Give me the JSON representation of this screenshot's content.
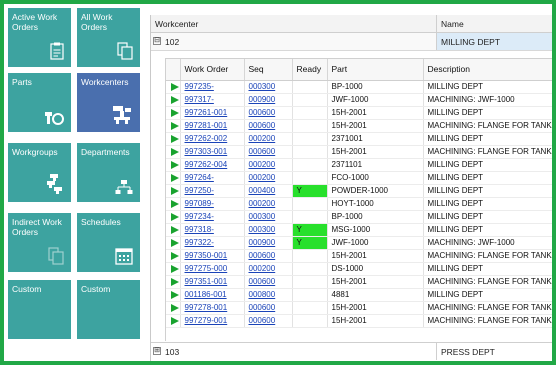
{
  "tiles": [
    {
      "label": "Active Work Orders",
      "icon": "clipboard-icon",
      "active": false
    },
    {
      "label": "All Work Orders",
      "icon": "documents-icon",
      "active": false
    },
    {
      "label": "Parts",
      "icon": "bolt-nut-icon",
      "active": false
    },
    {
      "label": "Workcenters",
      "icon": "machine-icon",
      "active": true
    },
    {
      "label": "Workgroups",
      "icon": "workgroup-machines-icon",
      "active": false
    },
    {
      "label": "Departments",
      "icon": "org-chart-icon",
      "active": false
    },
    {
      "label": "Indirect Work Orders",
      "icon": "documents-faded-icon",
      "active": false
    },
    {
      "label": "Schedules",
      "icon": "calendar-icon",
      "active": false
    },
    {
      "label": "Custom",
      "icon": "",
      "active": false
    },
    {
      "label": "Custom",
      "icon": "",
      "active": false
    }
  ],
  "grid": {
    "header": {
      "workcenter": "Workcenter",
      "name": "Name"
    },
    "groups": [
      {
        "id": "102",
        "name": "MILLING DEPT",
        "expander": "⊟"
      },
      {
        "id": "103",
        "name": "PRESS DEPT",
        "expander": "⊞"
      }
    ],
    "columns": [
      "Work Order",
      "Seq",
      "Ready",
      "Part",
      "Description"
    ],
    "rows": [
      {
        "wo": "997235-",
        "seq": "000300",
        "ready": "",
        "part": "BP-1000",
        "desc": "MILLING DEPT"
      },
      {
        "wo": "997317-",
        "seq": "000900",
        "ready": "",
        "part": "JWF-1000",
        "desc": "MACHINING: JWF-1000"
      },
      {
        "wo": "997261-001",
        "seq": "000600",
        "ready": "",
        "part": "15H-2001",
        "desc": "MILLING DEPT"
      },
      {
        "wo": "997281-001",
        "seq": "000600",
        "ready": "",
        "part": "15H-2001",
        "desc": "MACHINING: FLANGE FOR TANK"
      },
      {
        "wo": "997262-002",
        "seq": "000200",
        "ready": "",
        "part": "2371001",
        "desc": "MILLING DEPT"
      },
      {
        "wo": "997303-001",
        "seq": "000600",
        "ready": "",
        "part": "15H-2001",
        "desc": "MACHINING: FLANGE FOR TANK"
      },
      {
        "wo": "997262-004",
        "seq": "000200",
        "ready": "",
        "part": "2371101",
        "desc": "MILLING DEPT"
      },
      {
        "wo": "997264-",
        "seq": "000200",
        "ready": "",
        "part": "FCO-1000",
        "desc": "MILLING DEPT"
      },
      {
        "wo": "997250-",
        "seq": "000400",
        "ready": "Y",
        "part": "POWDER-1000",
        "desc": "MILLING DEPT"
      },
      {
        "wo": "997089-",
        "seq": "000200",
        "ready": "",
        "part": "HOYT-1000",
        "desc": "MILLING DEPT"
      },
      {
        "wo": "997234-",
        "seq": "000300",
        "ready": "",
        "part": "BP-1000",
        "desc": "MILLING DEPT"
      },
      {
        "wo": "997318-",
        "seq": "000300",
        "ready": "Y",
        "part": "MSG-1000",
        "desc": "MILLING DEPT"
      },
      {
        "wo": "997322-",
        "seq": "000900",
        "ready": "Y",
        "part": "JWF-1000",
        "desc": "MACHINING: JWF-1000"
      },
      {
        "wo": "997350-001",
        "seq": "000600",
        "ready": "",
        "part": "15H-2001",
        "desc": "MACHINING: FLANGE FOR TANK"
      },
      {
        "wo": "997275-000",
        "seq": "000200",
        "ready": "",
        "part": "DS-1000",
        "desc": "MILLING DEPT"
      },
      {
        "wo": "997351-001",
        "seq": "000600",
        "ready": "",
        "part": "15H-2001",
        "desc": "MACHINING: FLANGE FOR TANK"
      },
      {
        "wo": "001186-001",
        "seq": "000800",
        "ready": "",
        "part": "4881",
        "desc": "MILLING DEPT"
      },
      {
        "wo": "997278-001",
        "seq": "000600",
        "ready": "",
        "part": "15H-2001",
        "desc": "MACHINING: FLANGE FOR TANK"
      },
      {
        "wo": "997279-001",
        "seq": "000600",
        "ready": "",
        "part": "15H-2001",
        "desc": "MACHINING: FLANGE FOR TANK"
      }
    ]
  },
  "colors": {
    "tile": "#3da3a0",
    "tile_active": "#4a6fae",
    "frame": "#21a846",
    "ready": "#28e02c",
    "indicator": "#19a32f"
  }
}
